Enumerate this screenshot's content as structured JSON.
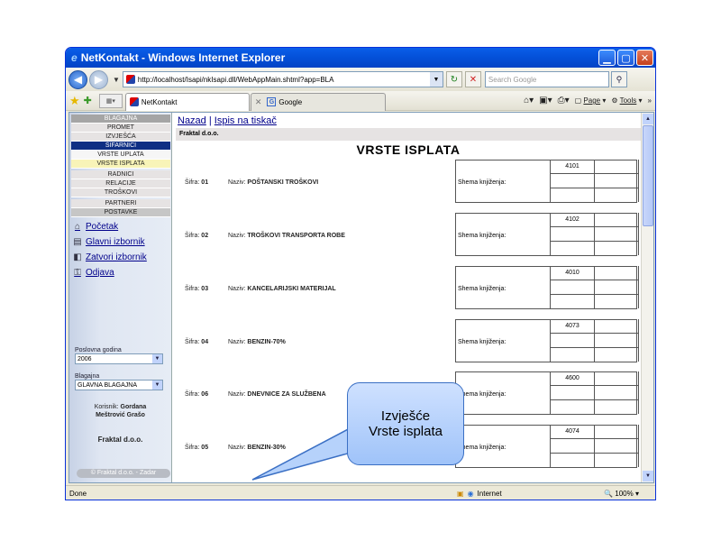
{
  "window": {
    "title": "NetKontakt - Windows Internet Explorer",
    "url": "http://localhost/Isapi/nkIsapi.dll/WebAppMain.shtml?app=BLA",
    "search_placeholder": "Search Google"
  },
  "tabs": [
    {
      "label": "NetKontakt"
    },
    {
      "label": "Google"
    }
  ],
  "command_bar": {
    "page_label": "Page",
    "tools_label": "Tools"
  },
  "sidebar": {
    "menu": [
      {
        "label": "BLAGAJNA",
        "style": "header"
      },
      {
        "label": "PROMET",
        "style": "normal"
      },
      {
        "label": "IZVJEŠĆA",
        "style": "normal"
      },
      {
        "label": "ŠIFARNICI",
        "style": "selected"
      },
      {
        "label": "VRSTE UPLATA",
        "style": "white"
      },
      {
        "label": "VRSTE ISPLATA",
        "style": "highlight"
      }
    ],
    "menu2": [
      {
        "label": "RADNICI"
      },
      {
        "label": "RELACIJE"
      },
      {
        "label": "TROŠKOVI"
      }
    ],
    "menu3": [
      {
        "label": "PARTNERI"
      },
      {
        "label": "POSTAVKE"
      }
    ],
    "links": [
      {
        "label": "Početak",
        "icon": "home-icon"
      },
      {
        "label": "Glavni izbornik",
        "icon": "menu-icon"
      },
      {
        "label": "Zatvori izbornik",
        "icon": "close-menu-icon"
      },
      {
        "label": "Odjava",
        "icon": "logout-icon"
      }
    ],
    "year_label": "Poslovna godina",
    "year_value": "2006",
    "cashbox_label": "Blagajna",
    "cashbox_value": "GLAVNA BLAGAJNA",
    "user_label": "Korisnik:",
    "user_name_1": "Gordana",
    "user_name_2": "Meštrović Grašo",
    "company": "Fraktal d.o.o.",
    "copyright": "© Fraktal d.o.o. - Zadar"
  },
  "main": {
    "nav_back": "Nazad",
    "separator": "|",
    "nav_print": "Ispis na tiskač",
    "company": "Fraktal d.o.o.",
    "title": "VRSTE ISPLATA",
    "sifra_label": "Šifra:",
    "naziv_label": "Naziv:",
    "shema_label": "Shema knjiženja:",
    "rows": [
      {
        "sifra": "01",
        "naziv": "POŠTANSKI TROŠKOVI",
        "konto": "4101"
      },
      {
        "sifra": "02",
        "naziv": "TROŠKOVI TRANSPORTA ROBE",
        "konto": "4102"
      },
      {
        "sifra": "03",
        "naziv": "KANCELARIJSKI MATERIJAL",
        "konto": "4010"
      },
      {
        "sifra": "04",
        "naziv": "BENZIN-70%",
        "konto": "4073"
      },
      {
        "sifra": "06",
        "naziv": "DNEVNICE ZA SLUŽBENA",
        "konto": "4600"
      },
      {
        "sifra": "05",
        "naziv": "BENZIN-30%",
        "konto": "4074"
      }
    ]
  },
  "status": {
    "text": "Done",
    "zone": "Internet",
    "zoom": "100%"
  },
  "callout": {
    "line1": "Izvješće",
    "line2": "Vrste isplata"
  }
}
